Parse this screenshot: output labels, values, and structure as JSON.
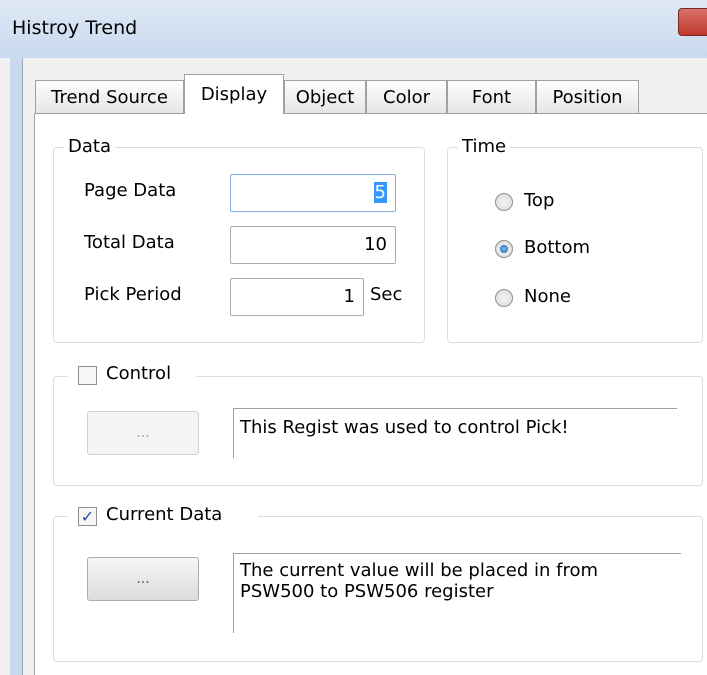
{
  "window": {
    "title": "Histroy Trend"
  },
  "tabs": [
    "Trend Source",
    "Display",
    "Object",
    "Color",
    "Font",
    "Position"
  ],
  "data_group": {
    "legend": "Data",
    "page_data": {
      "label": "Page Data",
      "value": "5"
    },
    "total_data": {
      "label": "Total Data",
      "value": "10"
    },
    "pick_period": {
      "label": "Pick Period",
      "value": "1",
      "unit": "Sec"
    }
  },
  "time_group": {
    "legend": "Time",
    "options": [
      "Top",
      "Bottom",
      "None"
    ],
    "selected": "Bottom"
  },
  "control_group": {
    "label": "Control",
    "checked": false,
    "button_label": "...",
    "description": "This Regist was used to control Pick!"
  },
  "current_data_group": {
    "label": "Current Data",
    "checked": true,
    "button_label": "...",
    "description_line1": "The current value will be placed in from",
    "description_line2": "PSW500 to PSW506 register"
  }
}
